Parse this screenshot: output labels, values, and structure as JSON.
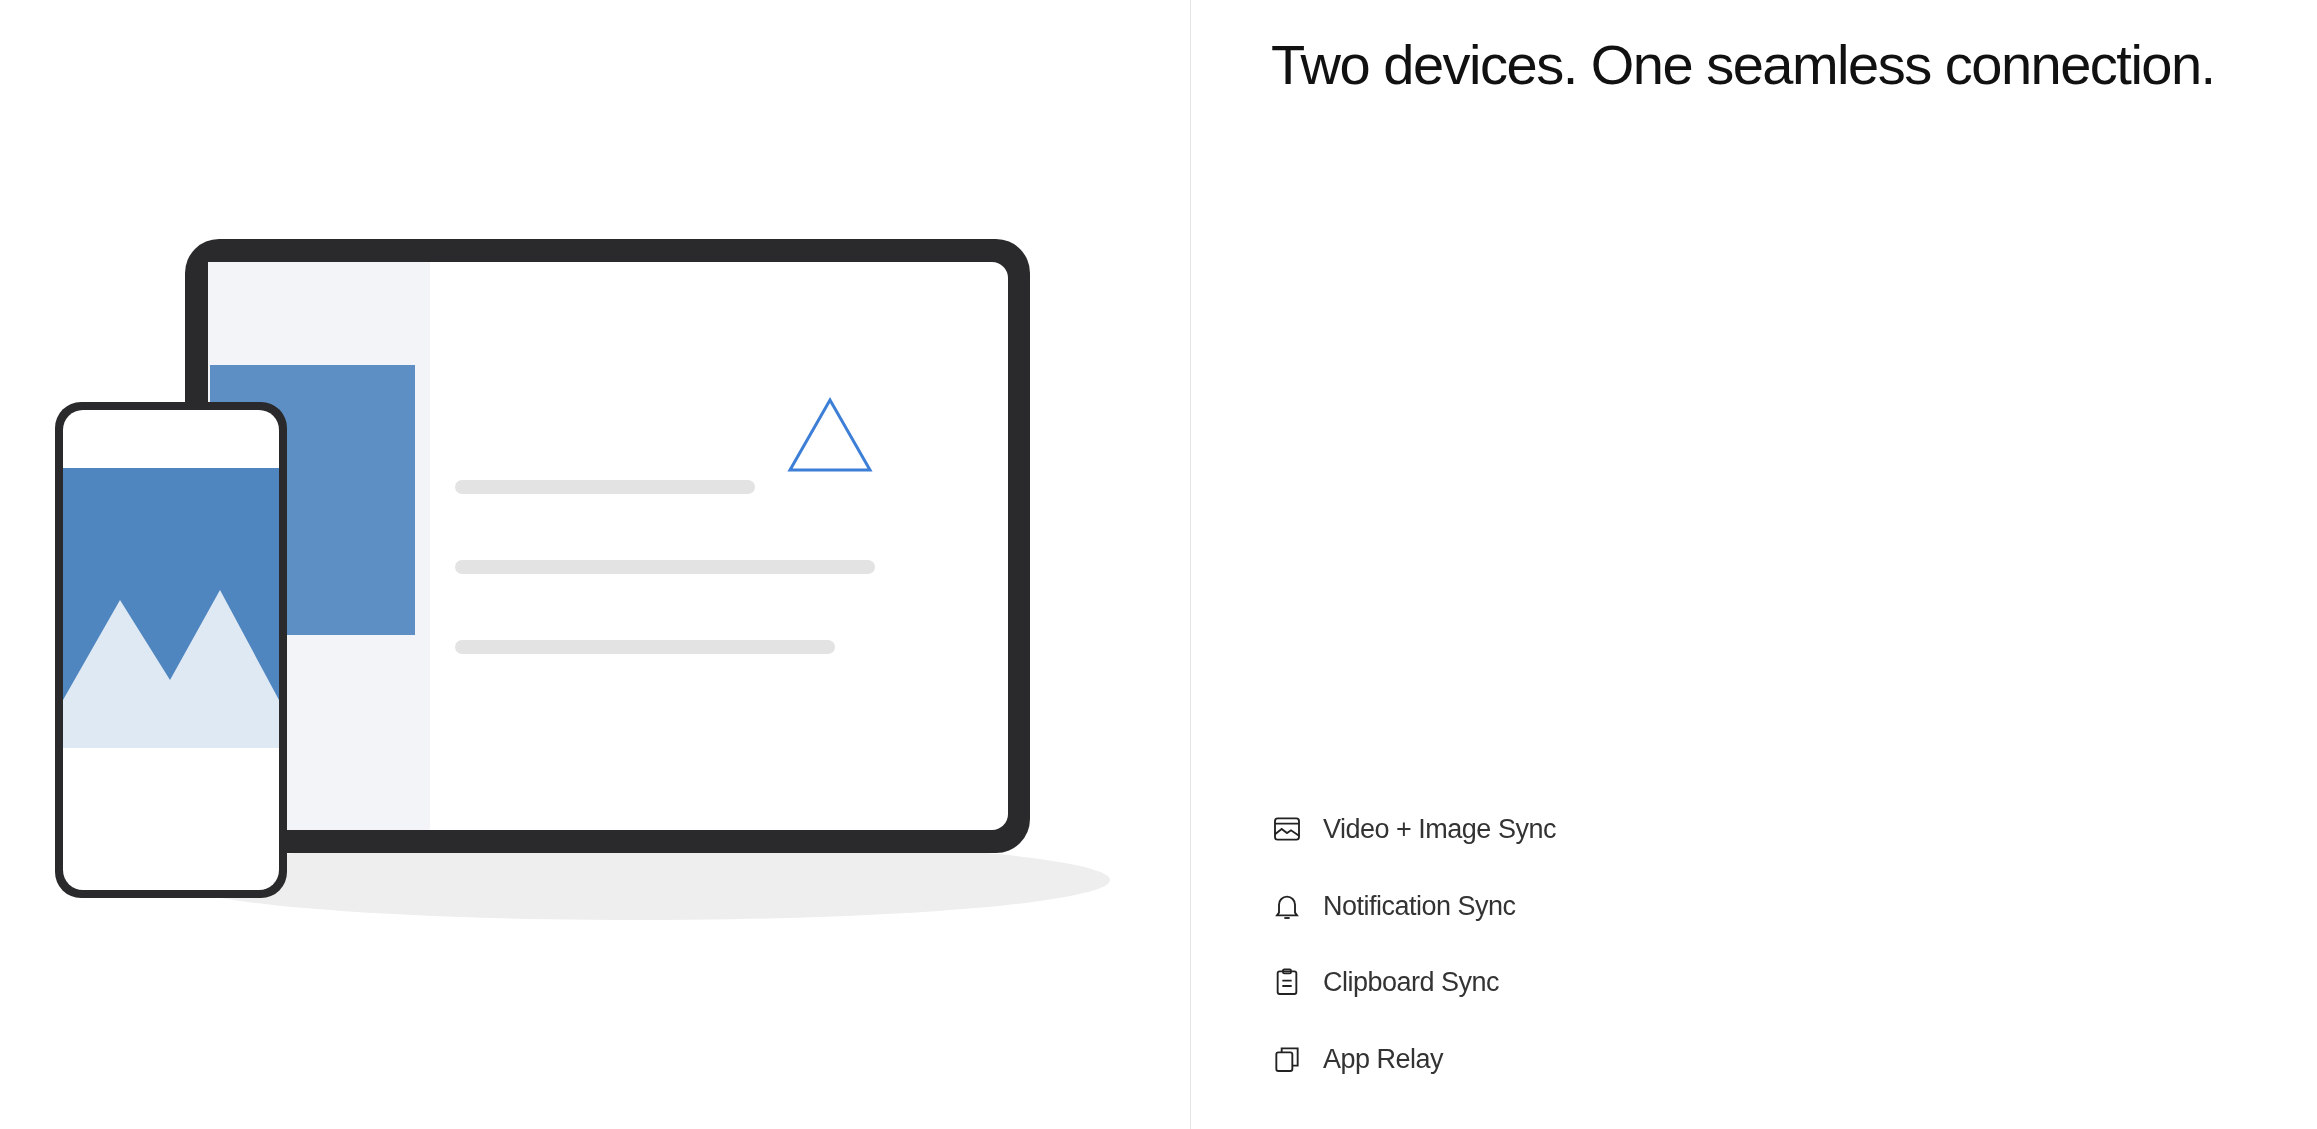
{
  "heading": "Two devices. One seamless connection.",
  "features": [
    {
      "label": "Video + Image Sync"
    },
    {
      "label": "Notification Sync"
    },
    {
      "label": "Clipboard Sync"
    },
    {
      "label": "App Relay"
    }
  ]
}
